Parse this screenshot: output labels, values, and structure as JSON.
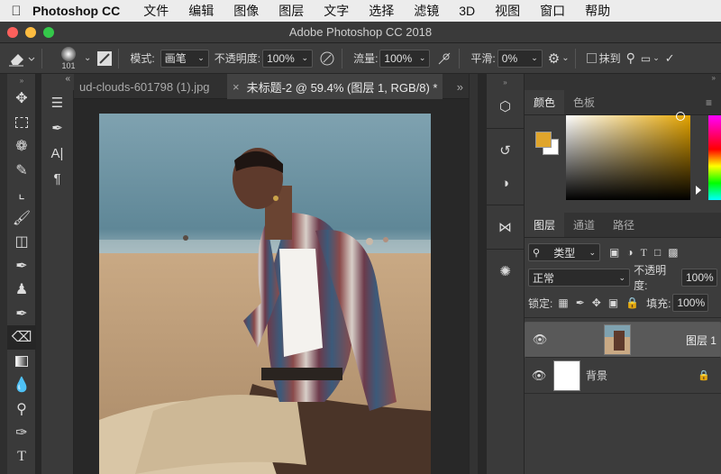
{
  "menubar": {
    "app_name": "Photoshop CC",
    "items": [
      "文件",
      "编辑",
      "图像",
      "图层",
      "文字",
      "选择",
      "滤镜",
      "3D",
      "视图",
      "窗口",
      "帮助"
    ]
  },
  "window": {
    "title": "Adobe Photoshop CC 2018"
  },
  "options": {
    "brush_size": "101",
    "mode_label": "模式:",
    "mode_value": "画笔",
    "opacity_label": "不透明度:",
    "opacity_value": "100%",
    "flow_label": "流量:",
    "flow_value": "100%",
    "smooth_label": "平滑:",
    "smooth_value": "0%",
    "erase_history_label": "抹到"
  },
  "tabs": [
    {
      "label": "ud-clouds-601798 (1).jpg"
    },
    {
      "label": "未标题-2 @ 59.4% (图层 1, RGB/8) *"
    }
  ],
  "color_panel": {
    "tabs": [
      "颜色",
      "色板"
    ],
    "foreground": "#e0a52b",
    "background": "#ffffff"
  },
  "layers_panel": {
    "tabs": [
      "图层",
      "通道",
      "路径"
    ],
    "filter_label": "类型",
    "blend_mode": "正常",
    "opacity_label": "不透明度:",
    "opacity_value": "100%",
    "lock_label": "锁定:",
    "fill_label": "填充:",
    "fill_value": "100%",
    "layers": [
      {
        "name": "图层 1",
        "selected": true
      },
      {
        "name": "背景",
        "selected": false,
        "locked": true
      }
    ]
  }
}
